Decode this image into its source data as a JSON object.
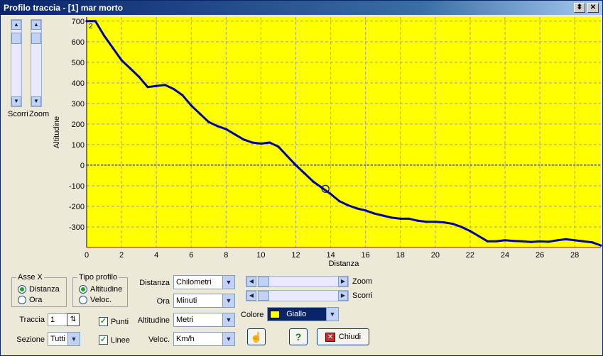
{
  "window": {
    "title": "Profilo traccia - [1] mar morto"
  },
  "titlebar_buttons": {
    "restore": "⬍",
    "close": "✕"
  },
  "left_panel": {
    "scroll_label": "Scorri",
    "zoom_label": "Zoom"
  },
  "chart_data": {
    "type": "line",
    "xlabel": "Distanza",
    "ylabel": "Altitudine",
    "xlim": [
      0,
      29.5
    ],
    "ylim": [
      -400,
      720
    ],
    "x_ticks": [
      0,
      2,
      4,
      6,
      8,
      10,
      12,
      14,
      16,
      18,
      20,
      22,
      24,
      26,
      28
    ],
    "y_ticks": [
      -300,
      -200,
      -100,
      0,
      100,
      200,
      300,
      400,
      500,
      600,
      700
    ],
    "grid": true,
    "background_color": "#ffff00",
    "line_color": "#0000a0",
    "zero_line": 0,
    "marker": {
      "x": 13.7,
      "y": -115
    },
    "corner_labels": [
      "2"
    ],
    "series": [
      {
        "x": [
          0,
          0.5,
          1,
          1.5,
          2,
          2.5,
          3,
          3.5,
          4,
          4.5,
          5,
          5.5,
          6,
          6.5,
          7,
          7.5,
          8,
          8.5,
          9,
          9.5,
          10,
          10.5,
          11,
          11.5,
          12,
          12.5,
          13,
          13.5,
          14,
          14.5,
          15,
          15.5,
          16,
          16.5,
          17,
          17.5,
          18,
          18.5,
          19,
          19.5,
          20,
          20.5,
          21,
          21.5,
          22,
          22.5,
          23,
          23.5,
          24,
          24.5,
          25,
          25.5,
          26,
          26.5,
          27,
          27.5,
          28,
          28.5,
          29,
          29.5
        ],
        "y": [
          700,
          700,
          630,
          570,
          510,
          470,
          430,
          380,
          385,
          390,
          370,
          340,
          290,
          250,
          210,
          190,
          175,
          150,
          125,
          110,
          105,
          110,
          90,
          45,
          0,
          -40,
          -80,
          -110,
          -140,
          -175,
          -195,
          -210,
          -220,
          -235,
          -245,
          -255,
          -260,
          -260,
          -270,
          -275,
          -275,
          -278,
          -285,
          -300,
          -320,
          -345,
          -370,
          -370,
          -365,
          -368,
          -370,
          -373,
          -370,
          -372,
          -365,
          -360,
          -365,
          -370,
          -375,
          -390
        ]
      }
    ]
  },
  "asse_x": {
    "legend": "Asse X",
    "options": [
      "Distanza",
      "Ora"
    ],
    "selected": 0
  },
  "tipo_profilo": {
    "legend": "Tipo profilo",
    "options": [
      "Altitudine",
      "Veloc."
    ],
    "selected": 0
  },
  "traccia": {
    "label": "Traccia",
    "value": "1"
  },
  "sezione": {
    "label": "Sezione",
    "value": "Tutti"
  },
  "checks": {
    "punti": "Punti",
    "linee": "Linee"
  },
  "units": {
    "distanza": {
      "label": "Distanza",
      "value": "Chilometri"
    },
    "ora": {
      "label": "Ora",
      "value": "Minuti"
    },
    "altitudine": {
      "label": "Altitudine",
      "value": "Metri"
    },
    "veloc": {
      "label": "Veloc.",
      "value": "Km/h"
    }
  },
  "sliders": {
    "zoom": "Zoom",
    "scorri": "Scorri"
  },
  "colore": {
    "label": "Colore",
    "value": "Giallo",
    "swatch": "#ffff00"
  },
  "buttons": {
    "help": "?",
    "close": "Chiudi"
  }
}
